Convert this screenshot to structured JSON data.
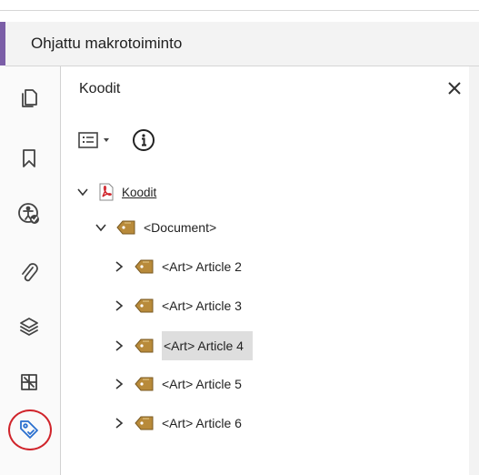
{
  "header": {
    "title": "Ohjattu makrotoiminto"
  },
  "sidebar": {
    "items": [
      {
        "name": "pages",
        "icon": "pages-icon"
      },
      {
        "name": "bookmarks",
        "icon": "bookmark-icon"
      },
      {
        "name": "accessibility",
        "icon": "accessibility-check-icon"
      },
      {
        "name": "attachments",
        "icon": "paperclip-icon"
      },
      {
        "name": "layers",
        "icon": "layers-icon"
      },
      {
        "name": "content",
        "icon": "content-icon"
      },
      {
        "name": "tags",
        "icon": "tag-icon",
        "active": true
      }
    ],
    "highlight_color": "#d0242b"
  },
  "panel": {
    "title": "Koodit",
    "close_icon": "close-icon",
    "tree": {
      "root": {
        "label": "Koodit",
        "icon": "pdf-icon",
        "expanded": true
      },
      "document": {
        "label": "<Document>",
        "icon": "tag-icon",
        "expanded": true
      },
      "articles": [
        {
          "label": "<Art> Article 2",
          "selected": false
        },
        {
          "label": "<Art> Article 3",
          "selected": false
        },
        {
          "label": "<Art> Article 4",
          "selected": true
        },
        {
          "label": "<Art> Article 5",
          "selected": false
        },
        {
          "label": "<Art> Article 6",
          "selected": false
        }
      ]
    }
  },
  "colors": {
    "accent": "#7b5ea7",
    "tag": "#b88a3a"
  }
}
